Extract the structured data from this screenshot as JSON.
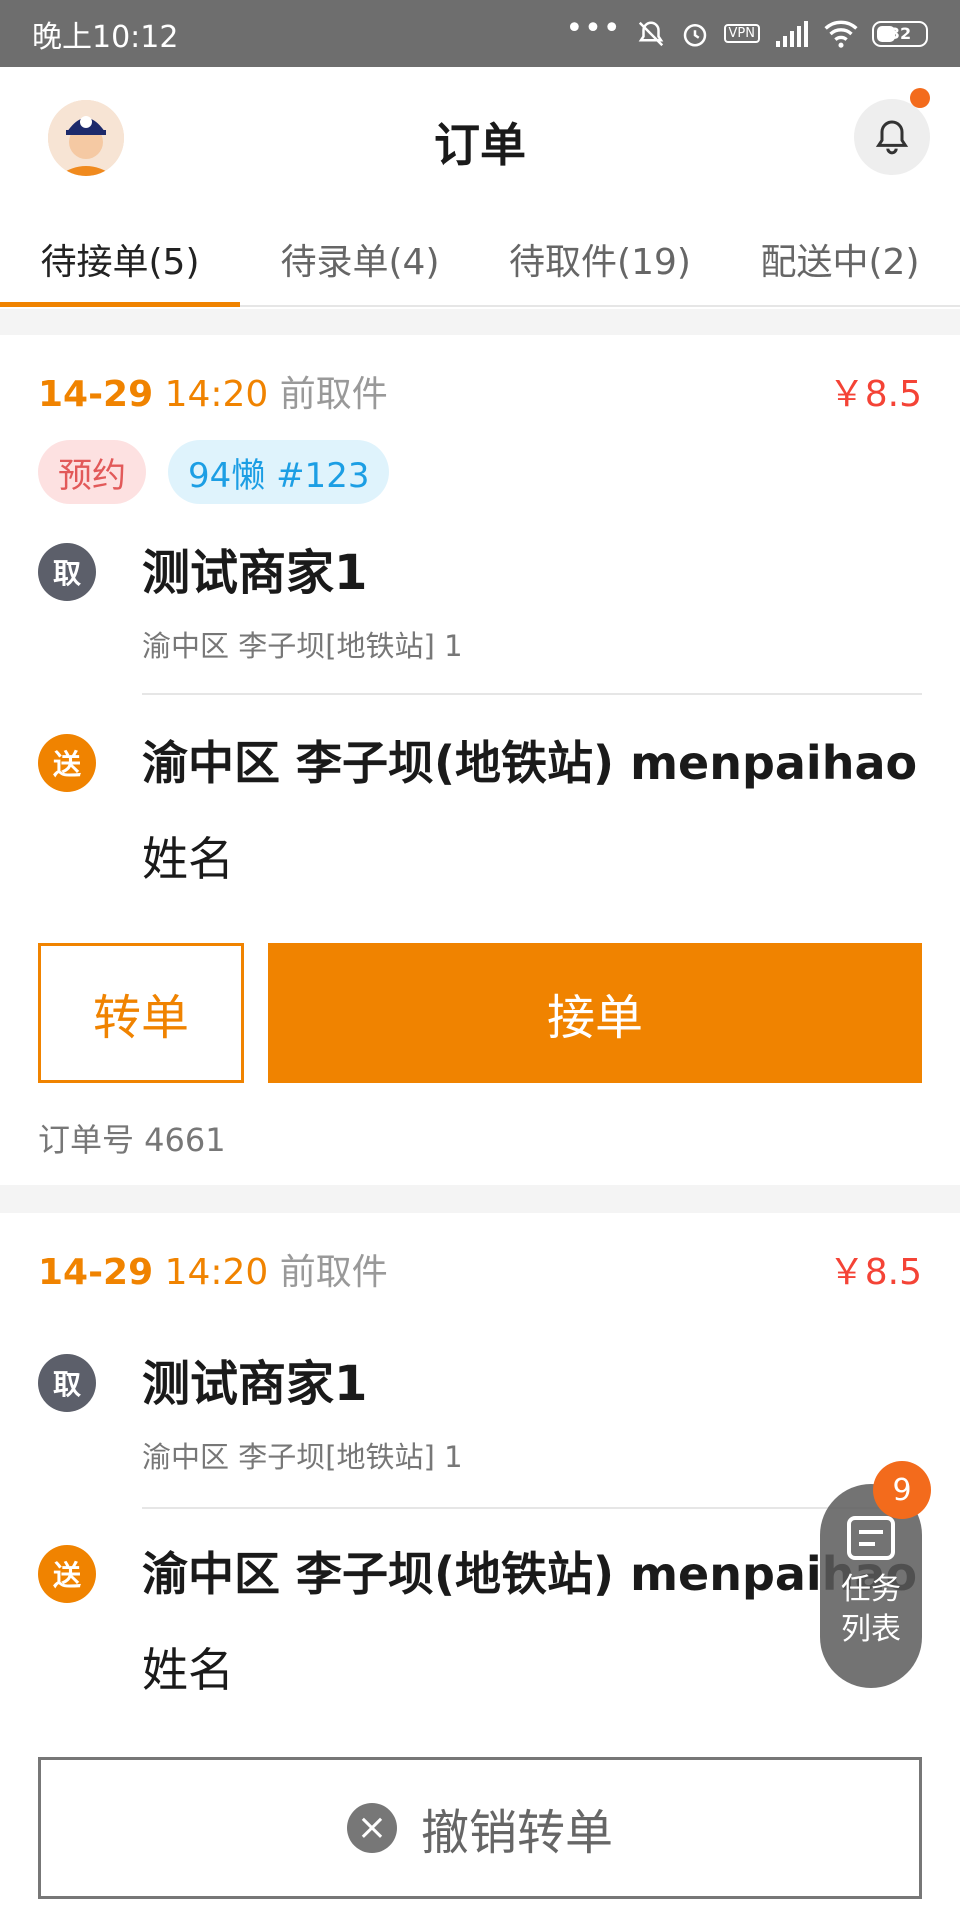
{
  "status_bar": {
    "time": "晚上10:12",
    "dots": "•••",
    "vpn": "VPN",
    "battery": "32"
  },
  "header": {
    "title": "订单"
  },
  "tabs": [
    {
      "label": "待接单(5)",
      "active": true
    },
    {
      "label": "待录单(4)",
      "active": false
    },
    {
      "label": "待取件(19)",
      "active": false
    },
    {
      "label": "配送中(2)",
      "active": false
    }
  ],
  "orders": [
    {
      "date": "14-29",
      "time": "14:20",
      "suffix": "前取件",
      "price": "￥8.5",
      "tags": {
        "reserve": "预约",
        "courier": "94懒 #123"
      },
      "pick_badge": "取",
      "shop_name": "测试商家1",
      "shop_addr": "渝中区 李子坝[地铁站] 1",
      "send_badge": "送",
      "dest_addr": "渝中区 李子坝(地铁站) menpaihao",
      "recipient": "姓名",
      "transfer_label": "转单",
      "accept_label": "接单",
      "order_no": "订单号 4661"
    },
    {
      "date": "14-29",
      "time": "14:20",
      "suffix": "前取件",
      "price": "￥8.5",
      "pick_badge": "取",
      "shop_name": "测试商家1",
      "shop_addr": "渝中区 李子坝[地铁站] 1",
      "send_badge": "送",
      "dest_addr": "渝中区 李子坝(地铁站) menpaihao",
      "recipient": "姓名",
      "cancel_label": "撤销转单",
      "cancel_icon": "×"
    }
  ],
  "floating_task": {
    "count": "9",
    "label_line1": "任务",
    "label_line2": "列表"
  }
}
